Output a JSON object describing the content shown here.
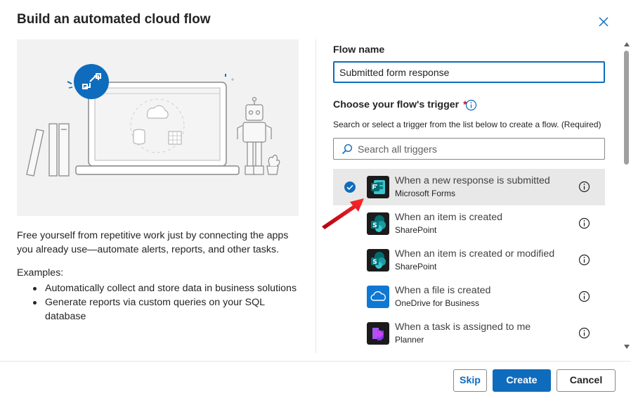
{
  "dialog": {
    "title": "Build an automated cloud flow"
  },
  "left": {
    "description": "Free yourself from repetitive work just by connecting the apps you already use—automate alerts, reports, and other tasks.",
    "examples_title": "Examples:",
    "examples": [
      "Automatically collect and store data in business solutions",
      "Generate reports via custom queries on your SQL database"
    ]
  },
  "form": {
    "flow_name_label": "Flow name",
    "flow_name_value": "Submitted form response",
    "trigger_label": "Choose your flow's trigger",
    "required_mark": "*",
    "trigger_help": "Search or select a trigger from the list below to create a flow. (Required)",
    "search_placeholder": "Search all triggers"
  },
  "triggers": [
    {
      "title": "When a new response is submitted",
      "connector": "Microsoft Forms",
      "selected": true,
      "icon": "forms-icon",
      "color": "#036c70"
    },
    {
      "title": "When an item is created",
      "connector": "SharePoint",
      "selected": false,
      "icon": "sharepoint-icon",
      "color": "#038387"
    },
    {
      "title": "When an item is created or modified",
      "connector": "SharePoint",
      "selected": false,
      "icon": "sharepoint-icon",
      "color": "#038387"
    },
    {
      "title": "When a file is created",
      "connector": "OneDrive for Business",
      "selected": false,
      "icon": "onedrive-icon",
      "color": "#0f78d4"
    },
    {
      "title": "When a task is assigned to me",
      "connector": "Planner",
      "selected": false,
      "icon": "planner-icon",
      "color": "#7719aa"
    }
  ],
  "footer": {
    "skip_label": "Skip",
    "create_label": "Create",
    "cancel_label": "Cancel"
  },
  "colors": {
    "accent": "#0f6cbd",
    "required": "#c50f1f",
    "selected_row": "#e8e8e8",
    "annotation_arrow": "#e81123"
  }
}
